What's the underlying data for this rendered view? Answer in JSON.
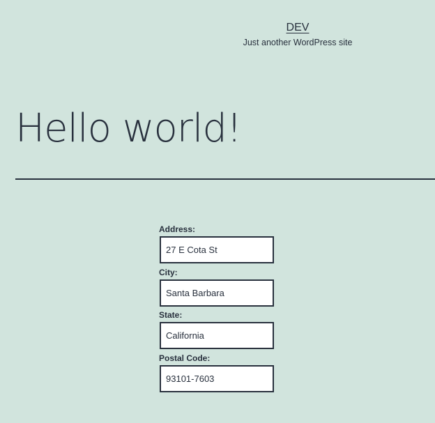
{
  "header": {
    "site_title": "DEV",
    "tagline": "Just another WordPress site"
  },
  "post": {
    "title": "Hello world!"
  },
  "form": {
    "address": {
      "label": "Address:",
      "value": "27 E Cota St"
    },
    "city": {
      "label": "City:",
      "value": "Santa Barbara"
    },
    "state": {
      "label": "State:",
      "value": "California"
    },
    "postal_code": {
      "label": "Postal Code:",
      "value": "93101-7603"
    }
  },
  "colors": {
    "background": "#d1e4dd",
    "text": "#28303d",
    "input_background": "#ffffff"
  }
}
